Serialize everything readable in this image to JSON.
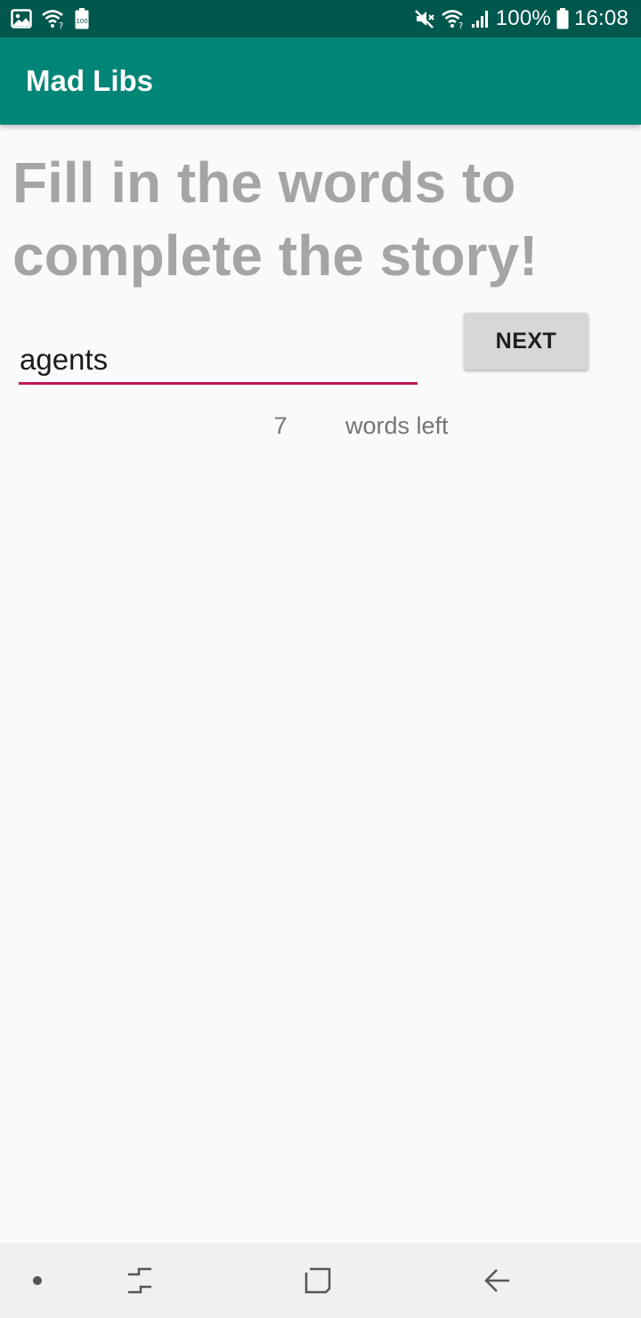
{
  "status_bar": {
    "left_icons": [
      "image-icon",
      "wifi-calling-icon",
      "battery-saver-icon"
    ],
    "battery_badge": "100",
    "battery_percent": "100%",
    "time": "16:08",
    "right_icons": [
      "mute-icon",
      "wifi-icon",
      "signal-icon",
      "battery-icon"
    ]
  },
  "app_bar": {
    "title": "Mad Libs",
    "color": "#008577"
  },
  "main": {
    "headline": "Fill in the words to complete the story!",
    "word_input": {
      "value": "agents",
      "accent_color": "#c2185b"
    },
    "next_label": "NEXT",
    "words_left_count": "7",
    "words_left_label": "words left"
  },
  "nav_bar": {
    "items": [
      "recent-dot-icon",
      "recents-icon",
      "home-icon",
      "back-icon"
    ]
  }
}
